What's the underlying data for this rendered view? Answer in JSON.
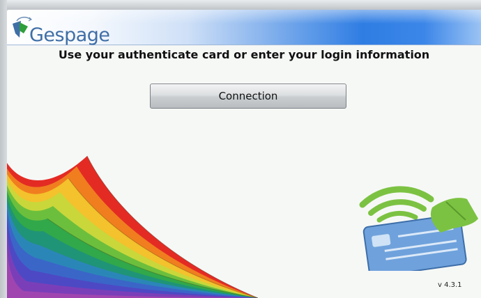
{
  "app": {
    "brand": "Gespage",
    "version": "v 4.3.1"
  },
  "main": {
    "title": "Use your authenticate card or enter your login information",
    "connect_label": "Connection"
  },
  "colors": {
    "header_blue": "#2f7de3",
    "logo_green": "#2f9e3c",
    "logo_blue": "#3f6fa6",
    "card_blue": "#6fa2dc",
    "hand_green": "#7cc242"
  },
  "icons": {
    "logo": "gespage-logo-icon",
    "decoration": "rainbow-pages-graphic",
    "card": "contactless-card-icon"
  }
}
